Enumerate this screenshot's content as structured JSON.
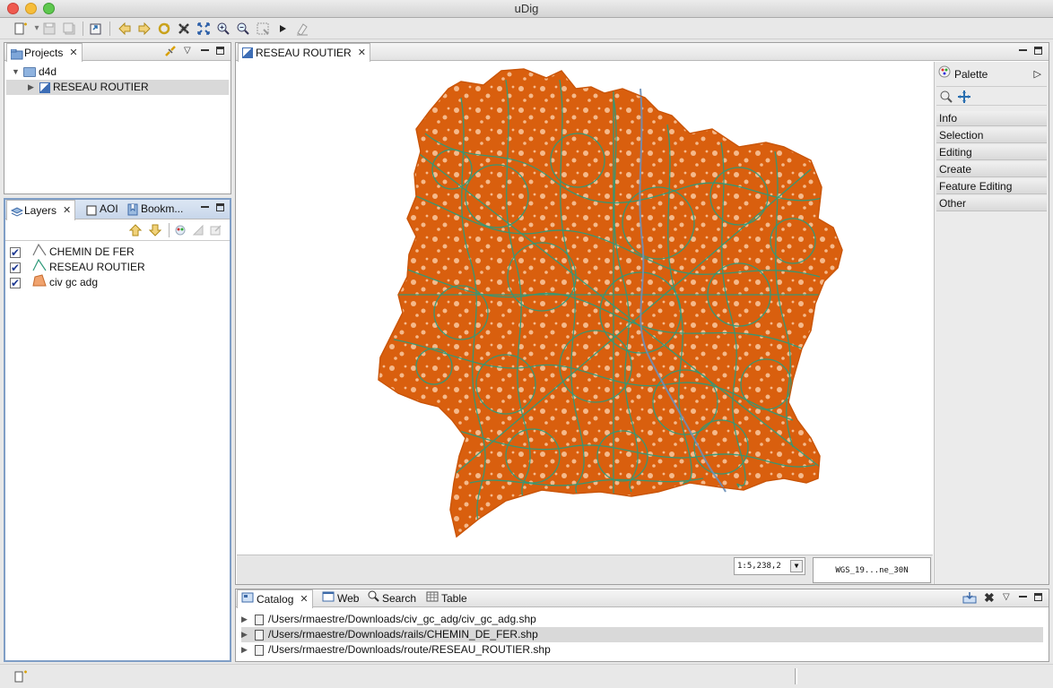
{
  "window": {
    "title": "uDig"
  },
  "toolbar": {
    "buttons": [
      "new",
      "save",
      "save-all",
      "export",
      "back",
      "forward",
      "refresh",
      "stop",
      "zoom-extent",
      "zoom-in",
      "zoom-out",
      "zoom-selection",
      "next",
      "clear"
    ]
  },
  "projects_panel": {
    "tab_label": "Projects",
    "tree": [
      {
        "label": "d4d",
        "expanded": true
      },
      {
        "label": "RESEAU ROUTIER",
        "expanded": false
      }
    ]
  },
  "layers_panel": {
    "tabs": [
      "Layers",
      "AOI",
      "Bookm..."
    ],
    "layers": [
      {
        "label": "CHEMIN DE FER",
        "checked": true,
        "icon": "line-icon"
      },
      {
        "label": "RESEAU ROUTIER",
        "checked": true,
        "icon": "line-icon"
      },
      {
        "label": "civ gc adg",
        "checked": true,
        "icon": "polygon-icon"
      }
    ]
  },
  "map_editor": {
    "tab_label": "RESEAU ROUTIER",
    "scale": "1:5,238,2",
    "crs": "WGS_19...ne_30N",
    "colors": {
      "land": "#d95f0e",
      "land_light": "#f5b98b",
      "roads": "#2f9a7a",
      "rail": "#6b8fb8"
    }
  },
  "palette": {
    "title": "Palette",
    "groups": [
      "Info",
      "Selection",
      "Editing",
      "Create",
      "Feature Editing",
      "Other"
    ]
  },
  "catalog_panel": {
    "tabs": [
      "Catalog",
      "Web",
      "Search",
      "Table"
    ],
    "rows": [
      "/Users/rmaestre/Downloads/civ_gc_adg/civ_gc_adg.shp",
      "/Users/rmaestre/Downloads/rails/CHEMIN_DE_FER.shp",
      "/Users/rmaestre/Downloads/route/RESEAU_ROUTIER.shp"
    ]
  }
}
